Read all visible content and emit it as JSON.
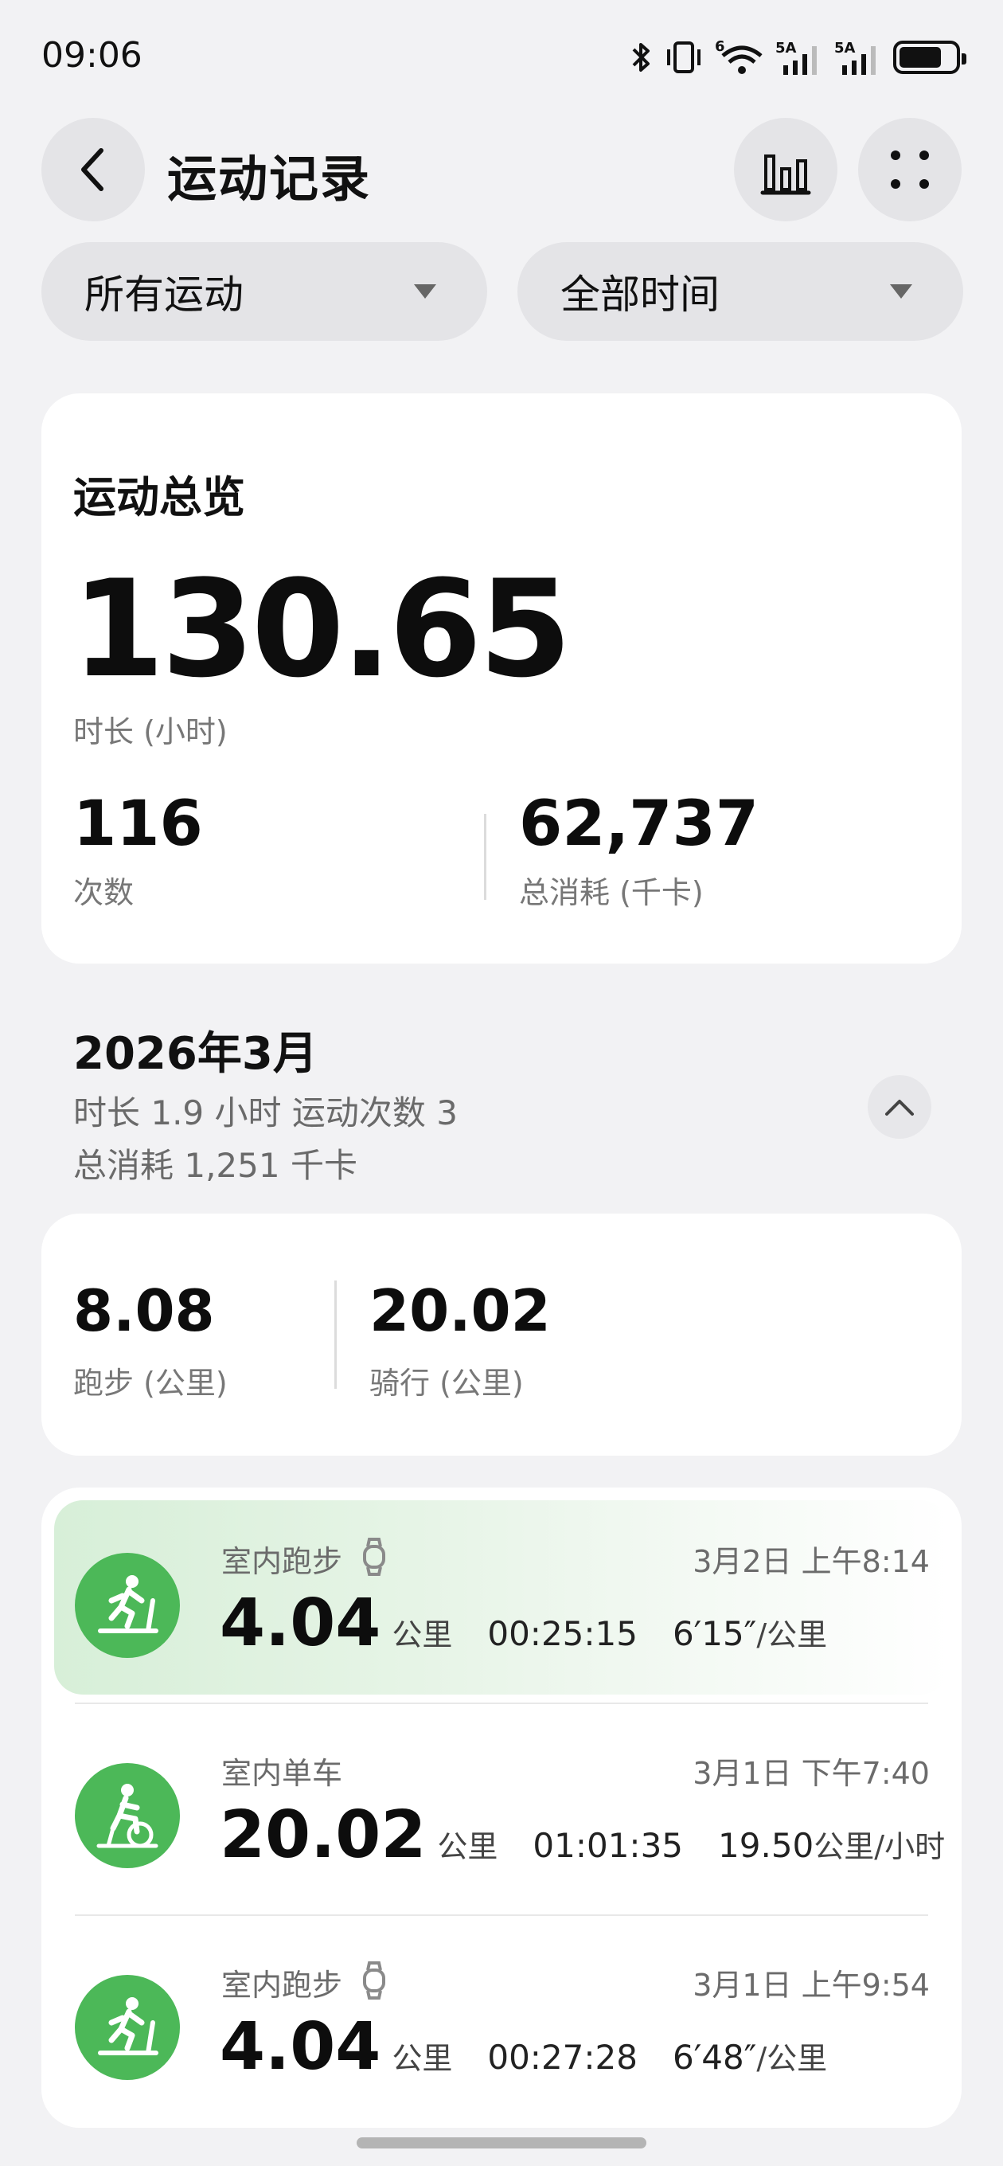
{
  "status_bar": {
    "time": "09:06",
    "network_5a_1": "5A",
    "network_5a_2": "5A",
    "wifi_badge": "6"
  },
  "header": {
    "title": "运动记录"
  },
  "filters": {
    "sport": "所有运动",
    "period": "全部时间"
  },
  "overview": {
    "title": "运动总览",
    "duration_value": "130.65",
    "duration_label": "时长 (小时)",
    "count_value": "116",
    "count_label": "次数",
    "calories_value": "62,737",
    "calories_label": "总消耗 (千卡)"
  },
  "month": {
    "title": "2026年3月",
    "line1": "时长 1.9 小时   运动次数 3",
    "line2": "总消耗 1,251 千卡"
  },
  "distances": {
    "run_value": "8.08",
    "run_label": "跑步 (公里)",
    "ride_value": "20.02",
    "ride_label": "骑行 (公里)"
  },
  "records": [
    {
      "type": "室内跑步",
      "date": "3月2日 上午8:14",
      "distance": "4.04",
      "unit": "公里",
      "duration": "00:25:15",
      "pace": "6′15″",
      "pace_unit": "/公里",
      "icon": "treadmill-icon",
      "watch": true
    },
    {
      "type": "室内单车",
      "date": "3月1日 下午7:40",
      "distance": "20.02",
      "unit": "公里",
      "duration": "01:01:35",
      "pace": "19.50",
      "pace_unit": " 公里/小时",
      "icon": "indoor-bike-icon",
      "watch": false
    },
    {
      "type": "室内跑步",
      "date": "3月1日 上午9:54",
      "distance": "4.04",
      "unit": "公里",
      "duration": "00:27:28",
      "pace": "6′48″",
      "pace_unit": "/公里",
      "icon": "treadmill-icon",
      "watch": true
    }
  ],
  "colors": {
    "accent_green": "#4cb858",
    "highlight_bg": "#d7efd8",
    "page_bg": "#f2f2f4"
  }
}
